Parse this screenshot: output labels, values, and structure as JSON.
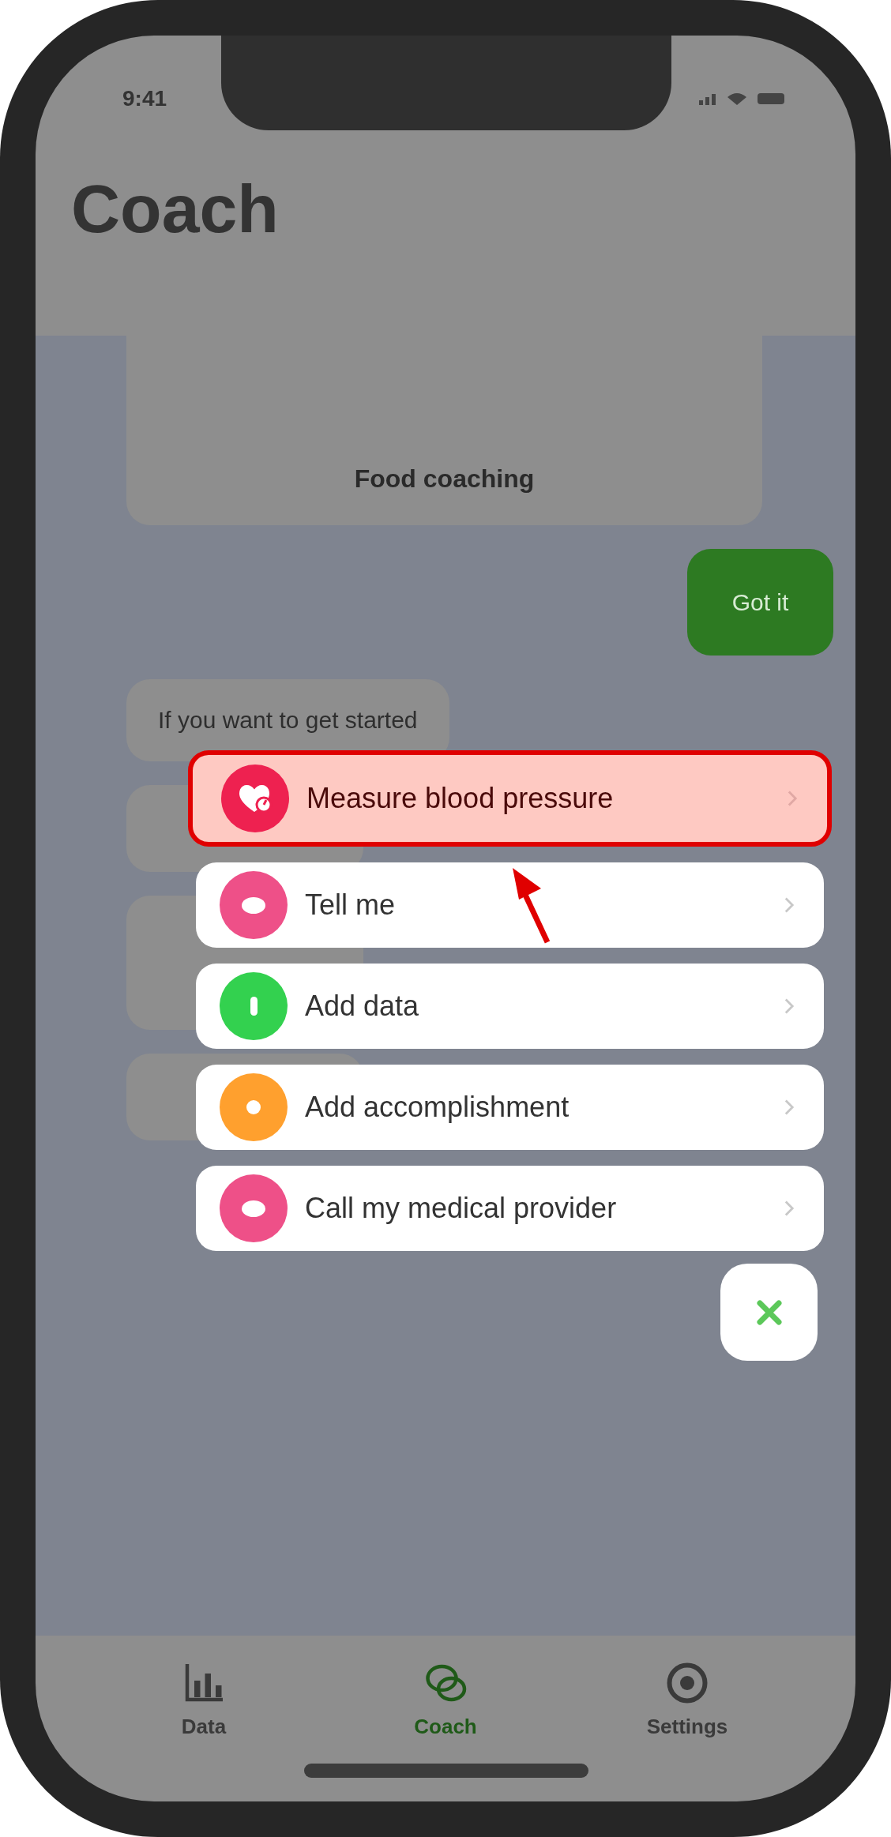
{
  "status_bar": {
    "time": "9:41"
  },
  "header": {
    "title": "Coach"
  },
  "chat": {
    "card": {
      "title": "Food coaching"
    },
    "messages": [
      {
        "kind": "sent",
        "text": "Got it"
      },
      {
        "kind": "received",
        "text": "If you want to get started"
      }
    ]
  },
  "menu": {
    "items": [
      {
        "kind": "heart",
        "label": "Measure blood pressure",
        "color": "#ee2150",
        "selected": true
      },
      {
        "kind": "chat",
        "label": "Tell me",
        "color": "#ee5088",
        "selected": false
      },
      {
        "kind": "plus",
        "label": "Add data",
        "color": "#33d14f",
        "selected": false
      },
      {
        "kind": "star",
        "label": "Add accomplishment",
        "color": "#ffa02e",
        "selected": false
      },
      {
        "kind": "chat",
        "label": "Call my medical provider",
        "color": "#ee5088",
        "selected": false
      }
    ]
  },
  "tab_bar": {
    "tabs": [
      {
        "kind": "chart",
        "label": "Data",
        "selected": false
      },
      {
        "kind": "chat",
        "label": "Coach",
        "selected": true
      },
      {
        "kind": "gear",
        "label": "Settings",
        "selected": false
      }
    ]
  }
}
